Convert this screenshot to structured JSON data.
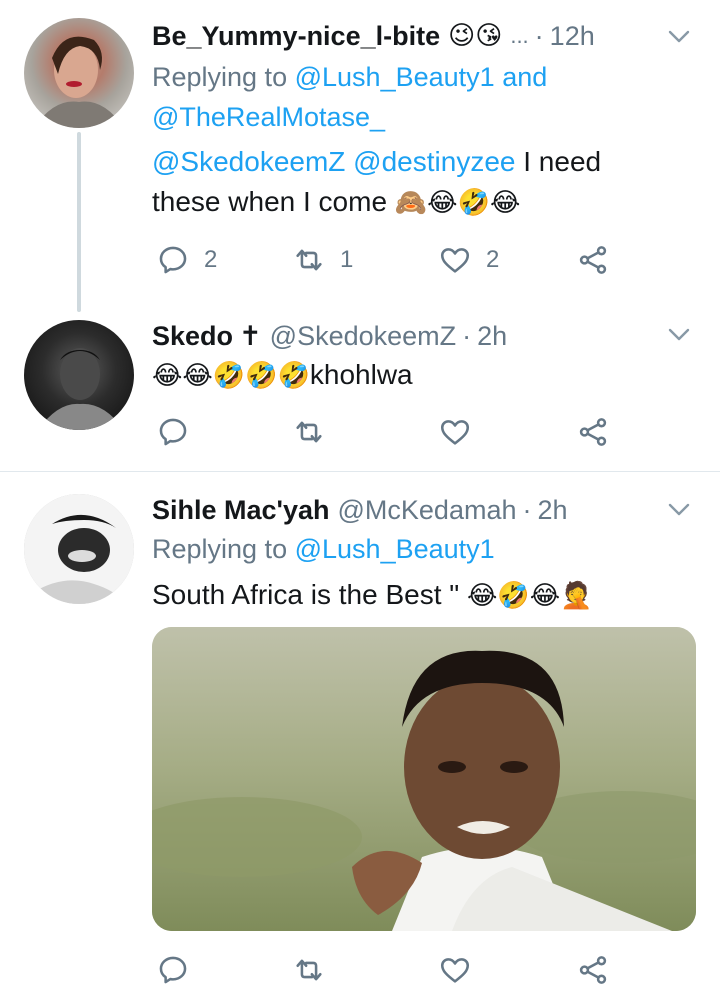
{
  "tweets": [
    {
      "name": "Be_Yummy-nice_l-bite",
      "name_emojis": "😉😘",
      "ellipsis": "...",
      "time": "12h",
      "replying_prefix": "Replying to",
      "replying_to_1": "@Lush_Beauty1",
      "replying_and": "and",
      "replying_to_2": "@TheRealMotase_",
      "mention_1": "@SkedokeemZ",
      "mention_2": "@destinyzee",
      "text_1": "I need",
      "text_2": "these when I come",
      "text_emojis": "🙈😂🤣😂",
      "reply_count": "2",
      "retweet_count": "1",
      "like_count": "2"
    },
    {
      "name": "Skedo",
      "name_symbol": "✝",
      "handle": "@SkedokeemZ",
      "time": "2h",
      "text_emojis": "😂😂🤣🤣🤣",
      "text": "khohlwa"
    },
    {
      "name": "Sihle Mac'yah",
      "handle": "@McKedamah",
      "time": "2h",
      "replying_prefix": "Replying to",
      "replying_to_1": "@Lush_Beauty1",
      "text": "South Africa is the Best \"",
      "text_emojis": "😂🤣😂🤦"
    }
  ],
  "icons": {
    "reply": "reply-icon",
    "retweet": "retweet-icon",
    "like": "heart-icon",
    "share": "share-icon",
    "menu": "chevron-down-icon"
  },
  "colors": {
    "link": "#1da1f2",
    "secondary": "#657786",
    "thread_line": "#cfd9de"
  }
}
